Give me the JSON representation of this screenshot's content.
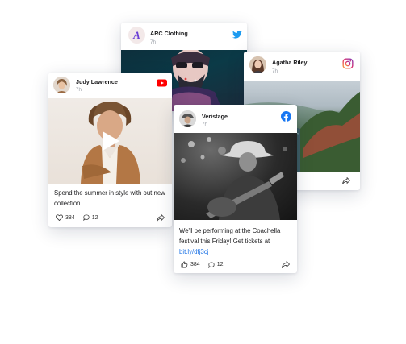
{
  "cards": {
    "arc": {
      "account": "ARC Clothing",
      "time": "7h",
      "avatar_letter": "A",
      "network_icon": "twitter-icon",
      "network_color": "#1d9bf0"
    },
    "agatha": {
      "account": "Agatha Riley",
      "time": "7h",
      "network_icon": "instagram-icon",
      "network_color": "#d6297a"
    },
    "judy": {
      "account": "Judy Lawrence",
      "time": "7h",
      "network_icon": "youtube-icon",
      "network_color": "#ff0000",
      "caption": "Spend the summer in style with out new collection.",
      "likes": "384",
      "comments": "12"
    },
    "veristage": {
      "account": "Veristage",
      "time": "7h",
      "network_icon": "facebook-icon",
      "network_color": "#1877f2",
      "caption": "We'll be performing at the Coachella festival this Friday! Get tickets at",
      "link": "bit.ly/dfj3cj",
      "likes": "384",
      "comments": "12"
    }
  }
}
